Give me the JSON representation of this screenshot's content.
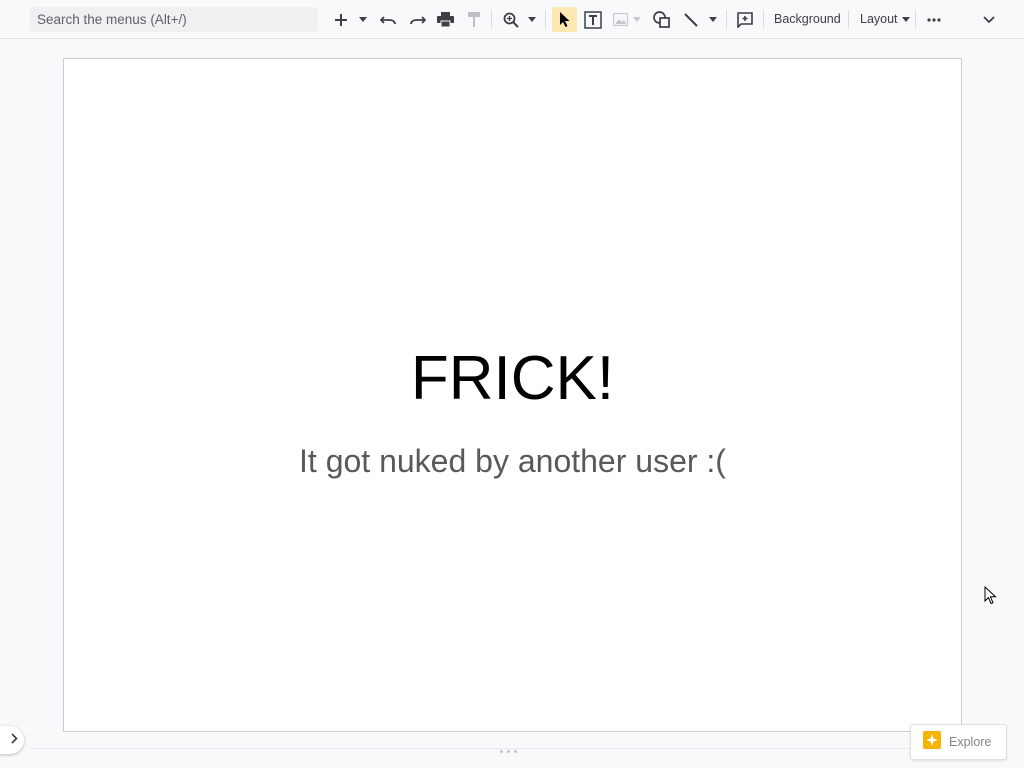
{
  "toolbar": {
    "search_placeholder": "Search the menus (Alt+/)",
    "background_label": "Background",
    "layout_label": "Layout",
    "icons": [
      "plus-icon",
      "dropdown-arrow-icon",
      "undo-icon",
      "redo-icon",
      "print-icon",
      "paint-format-icon",
      "zoom-icon",
      "select-cursor-icon",
      "text-box-icon",
      "image-icon",
      "shapes-icon",
      "line-icon",
      "comment-icon",
      "more-options-icon",
      "collapse-chevron-icon"
    ],
    "accent_color": "#fce8b2"
  },
  "slide": {
    "title": "FRICK!",
    "subtitle": "It got nuked by another user :("
  },
  "explore": {
    "label": "Explore",
    "icon_color": "#f4b400"
  }
}
